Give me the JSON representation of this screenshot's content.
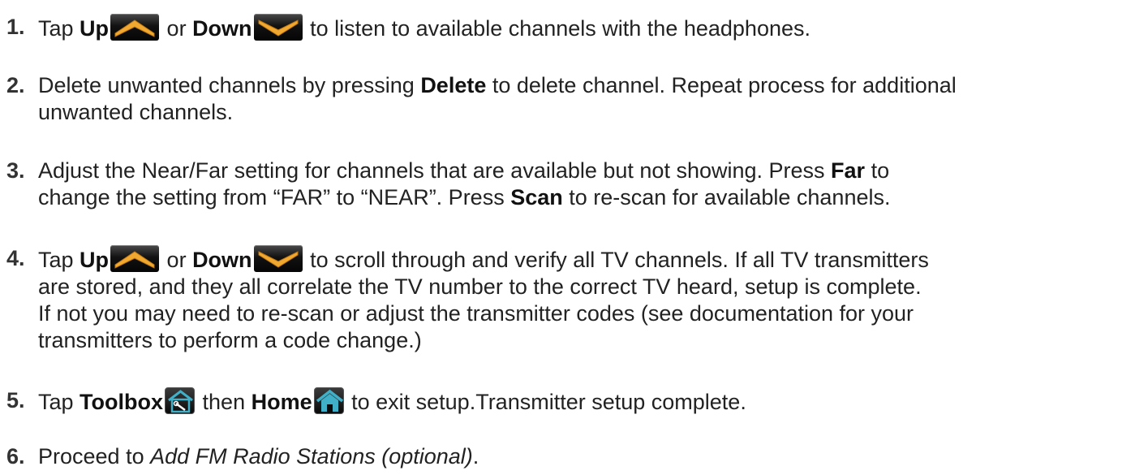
{
  "steps": [
    {
      "number": "1.",
      "lines": [
        [
          {
            "t": "text",
            "v": "Tap "
          },
          {
            "t": "bold",
            "v": "Up"
          },
          {
            "t": "icon",
            "icon": "up-arrow-icon"
          },
          {
            "t": "text",
            "v": " or "
          },
          {
            "t": "bold",
            "v": "Down"
          },
          {
            "t": "icon",
            "icon": "down-arrow-icon"
          },
          {
            "t": "text",
            "v": " to listen to available channels with the headphones."
          }
        ]
      ]
    },
    {
      "number": "2.",
      "lines": [
        [
          {
            "t": "text",
            "v": "Delete unwanted channels by pressing "
          },
          {
            "t": "bold",
            "v": "Delete"
          },
          {
            "t": "text",
            "v": " to delete channel. Repeat process for additional"
          }
        ],
        [
          {
            "t": "text",
            "v": "unwanted channels."
          }
        ]
      ]
    },
    {
      "number": "3.",
      "lines": [
        [
          {
            "t": "text",
            "v": "Adjust the Near/Far setting for channels that are available but not showing. Press "
          },
          {
            "t": "bold",
            "v": "Far"
          },
          {
            "t": "text",
            "v": " to"
          }
        ],
        [
          {
            "t": "text",
            "v": "change the setting from “FAR” to “NEAR”. Press "
          },
          {
            "t": "bold",
            "v": "Scan"
          },
          {
            "t": "text",
            "v": " to re-scan for available channels."
          }
        ]
      ]
    },
    {
      "number": "4.",
      "lines": [
        [
          {
            "t": "text",
            "v": "Tap "
          },
          {
            "t": "bold",
            "v": "Up"
          },
          {
            "t": "icon",
            "icon": "up-arrow-icon"
          },
          {
            "t": "text",
            "v": " or "
          },
          {
            "t": "bold",
            "v": "Down"
          },
          {
            "t": "icon",
            "icon": "down-arrow-icon"
          },
          {
            "t": "text",
            "v": " to scroll through and verify all TV channels. If all TV transmitters"
          }
        ],
        [
          {
            "t": "text",
            "v": "are stored, and they all correlate the TV number to the correct TV heard, setup is complete."
          }
        ],
        [
          {
            "t": "text",
            "v": "If not you may need to re-scan or adjust the transmitter codes (see documentation for your"
          }
        ],
        [
          {
            "t": "text",
            "v": "transmitters to perform a code change.)"
          }
        ]
      ]
    },
    {
      "number": "5.",
      "lines": [
        [
          {
            "t": "text",
            "v": "Tap "
          },
          {
            "t": "bold",
            "v": "Toolbox"
          },
          {
            "t": "icon",
            "icon": "toolbox-icon"
          },
          {
            "t": "text",
            "v": " then "
          },
          {
            "t": "bold",
            "v": "Home"
          },
          {
            "t": "icon",
            "icon": "home-icon"
          },
          {
            "t": "text",
            "v": " to exit setup.Transmitter setup complete."
          }
        ]
      ]
    },
    {
      "number": "6.",
      "lines": [
        [
          {
            "t": "text",
            "v": "Proceed to "
          },
          {
            "t": "italic",
            "v": "Add FM Radio Stations (optional)"
          },
          {
            "t": "text",
            "v": "."
          }
        ]
      ]
    }
  ],
  "colors": {
    "text": "#222222",
    "arrow_orange": "#f0a830",
    "icon_teal": "#3fb0c8"
  }
}
